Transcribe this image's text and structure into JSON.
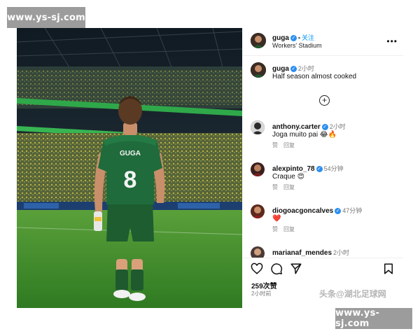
{
  "watermark": {
    "top_left": "www.ys-sj.com",
    "bottom_right": "www.ys-sj.com"
  },
  "photo": {
    "jersey_name": "GUGA",
    "jersey_number": "8"
  },
  "header": {
    "username": "guga",
    "separator": "•",
    "follow_label": "关注",
    "location": "Workers' Stadium",
    "more_label": "•••"
  },
  "caption": {
    "username": "guga",
    "time": "2小时",
    "text": "Half season almost cooked"
  },
  "load_more_label": "+",
  "comments": [
    {
      "username": "anthony.carter",
      "verified": true,
      "time": "2小时",
      "text": "Joga muito pai 😂🔥",
      "like_label": "赞",
      "reply_label": "回复",
      "avatar_color": "#2b2b2b"
    },
    {
      "username": "alexpinto_78",
      "verified": true,
      "time": "54分钟",
      "text": "Craque 😍",
      "like_label": "赞",
      "reply_label": "回复",
      "avatar_color": "#3b1f1f"
    },
    {
      "username": "diogoacgoncalves",
      "verified": true,
      "time": "47分钟",
      "text": "❤️",
      "like_label": "赞",
      "reply_label": "回复",
      "avatar_color": "#5a2a1e"
    },
    {
      "username": "marianaf_mendes",
      "verified": false,
      "time": "2小时",
      "text": "",
      "like_label": "",
      "reply_label": "",
      "avatar_color": "#4a3a35"
    }
  ],
  "actions": {
    "likes": "259次赞",
    "posted_ago": "2小时前"
  },
  "source_watermark": "头条@湖北足球网",
  "colors": {
    "verified": "#2b8ef0",
    "follow": "#0095f6",
    "jersey": "#1f6b3b",
    "pitch": "#3f8a2a"
  }
}
